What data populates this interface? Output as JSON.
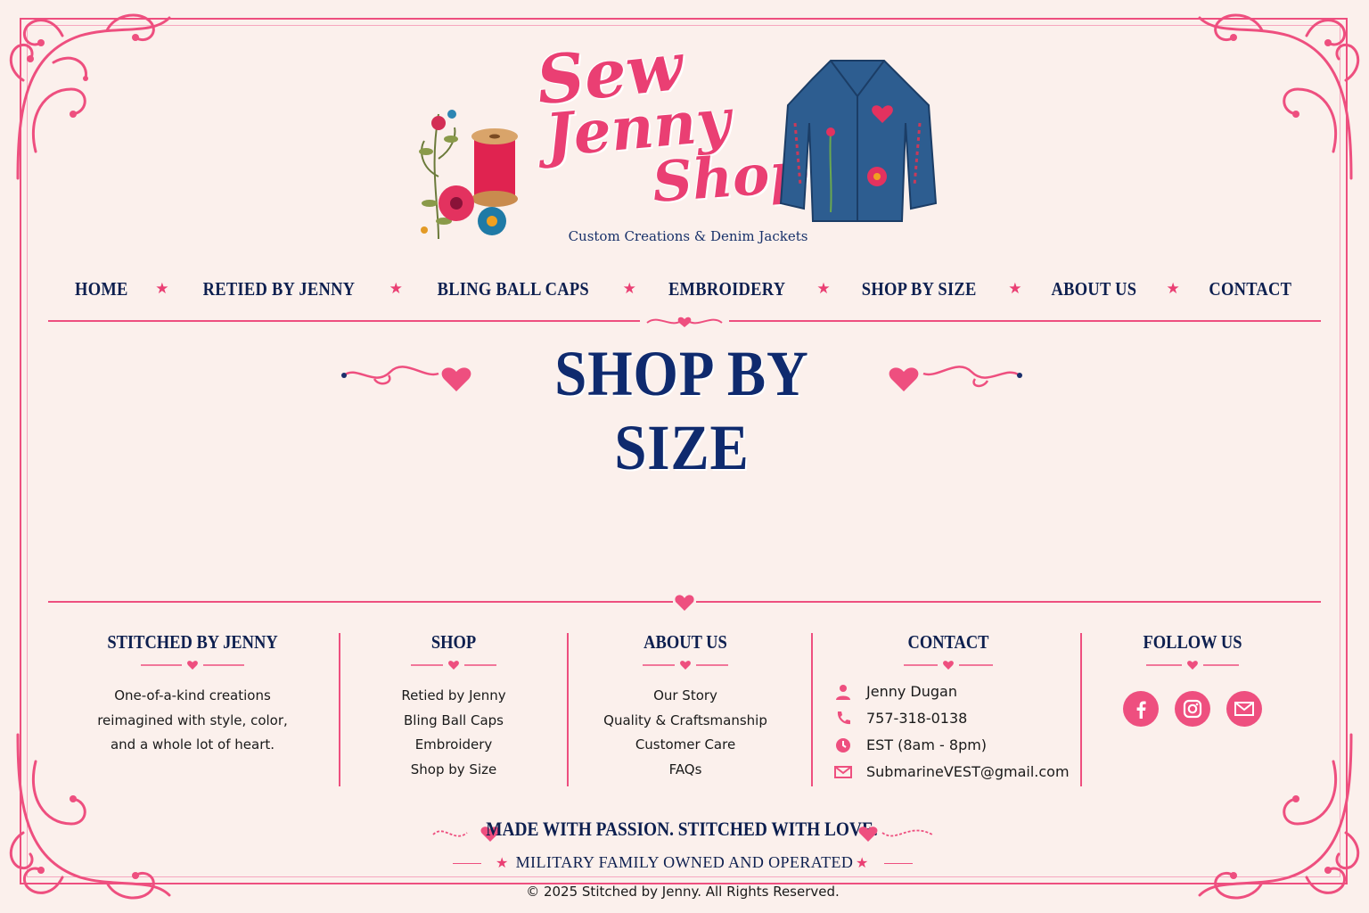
{
  "brand": {
    "logo_line1": "Sew",
    "logo_line2": "Jenny",
    "logo_line3": "Shop",
    "tagline": "Custom Creations & Denim Jackets"
  },
  "colors": {
    "pink": "#ee4f7f",
    "navy": "#0d1f4f",
    "background": "#fbf0ec",
    "denim": "#2d5d90"
  },
  "nav": {
    "items": [
      {
        "label": "HOME"
      },
      {
        "label": "RETIED BY JENNY"
      },
      {
        "label": "BLING BALL CAPS"
      },
      {
        "label": "EMBROIDERY"
      },
      {
        "label": "SHOP BY SIZE"
      },
      {
        "label": "ABOUT US"
      },
      {
        "label": "CONTACT"
      }
    ],
    "separator": "★"
  },
  "main": {
    "title": "SHOP BY SIZE"
  },
  "footer": {
    "about_col": {
      "heading": "STITCHED BY JENNY",
      "lines": [
        "One-of-a-kind creations",
        "reimagined with style, color,",
        "and a whole lot of heart."
      ]
    },
    "shop_col": {
      "heading": "SHOP",
      "links": [
        "Retied by Jenny",
        "Bling Ball Caps",
        "Embroidery",
        "Shop by Size"
      ]
    },
    "aboutus_col": {
      "heading": "ABOUT US",
      "links": [
        "Our Story",
        "Quality & Craftsmanship",
        "Customer Care",
        "FAQs"
      ]
    },
    "contact_col": {
      "heading": "CONTACT",
      "name": "Jenny Dugan",
      "phone": "757-318-0138",
      "hours": "EST (8am - 8pm)",
      "email": "SubmarineVEST@gmail.com"
    },
    "follow_col": {
      "heading": "FOLLOW US",
      "icons": [
        "facebook-icon",
        "instagram-icon",
        "email-icon"
      ]
    },
    "passion": "MADE WITH PASSION. STITCHED WITH LOVE.",
    "military": "MILITARY FAMILY OWNED AND OPERATED",
    "copyright": "© 2025 Stitched by Jenny. All Rights Reserved."
  }
}
